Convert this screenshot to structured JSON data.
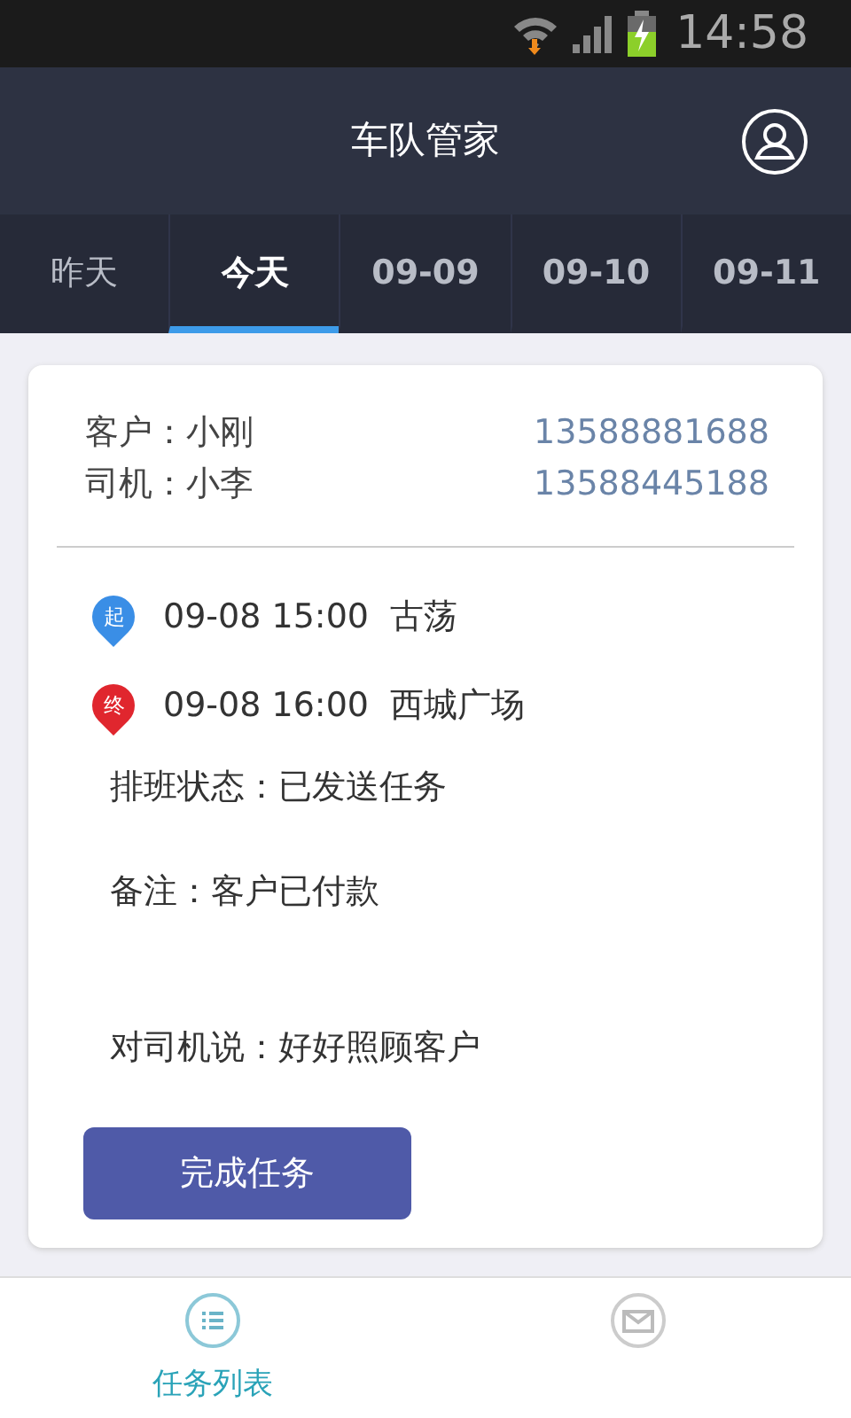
{
  "status_bar": {
    "time": "14:58"
  },
  "header": {
    "title": "车队管家"
  },
  "tabs": [
    {
      "label": "昨天",
      "selected": false
    },
    {
      "label": "今天",
      "selected": true
    },
    {
      "label": "09-09",
      "selected": false
    },
    {
      "label": "09-10",
      "selected": false
    },
    {
      "label": "09-11",
      "selected": false
    }
  ],
  "task": {
    "contacts": [
      {
        "label": "客户：小刚",
        "phone": "13588881688"
      },
      {
        "label": "司机：小李",
        "phone": "13588445188"
      }
    ],
    "stops": [
      {
        "pin": "起",
        "color": "#3a8ee6",
        "time": "09-08 15:00",
        "place": "古荡"
      },
      {
        "pin": "终",
        "color": "#e0262e",
        "time": "09-08 16:00",
        "place": "西城广场"
      }
    ],
    "notes": [
      "排班状态：已发送任务",
      "备注：客户已付款",
      "对司机说：好好照顾客户"
    ],
    "button": "完成任务"
  },
  "bottom_nav": [
    {
      "kind": "list",
      "label": "任务列表",
      "selected": true
    },
    {
      "kind": "mail",
      "selected": false
    }
  ]
}
